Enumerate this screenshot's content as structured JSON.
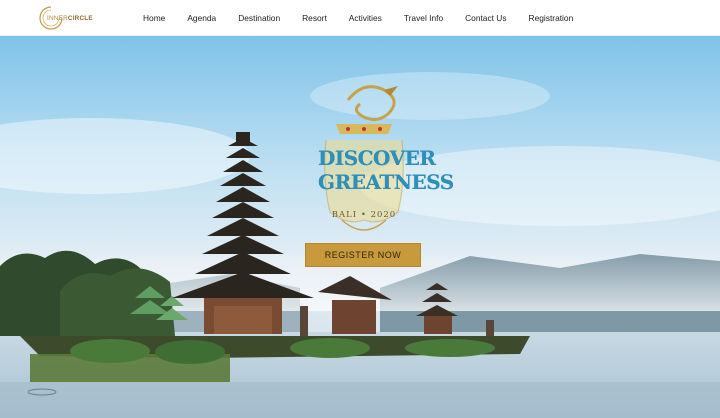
{
  "logo": {
    "text_light": "INNER",
    "text_bold": "CIRCLE"
  },
  "nav": [
    {
      "label": "Home"
    },
    {
      "label": "Agenda"
    },
    {
      "label": "Destination"
    },
    {
      "label": "Resort"
    },
    {
      "label": "Activities"
    },
    {
      "label": "Travel Info"
    },
    {
      "label": "Contact Us"
    },
    {
      "label": "Registration"
    }
  ],
  "hero": {
    "brand_line1": "DISCOVER",
    "brand_line2": "GREATNESS",
    "brand_sub": "BALI • 2020",
    "cta_label": "REGISTER NOW"
  },
  "colors": {
    "accent_gold": "#c99a3b",
    "brand_blue": "#2e8fb8",
    "nav_text": "#222222"
  }
}
